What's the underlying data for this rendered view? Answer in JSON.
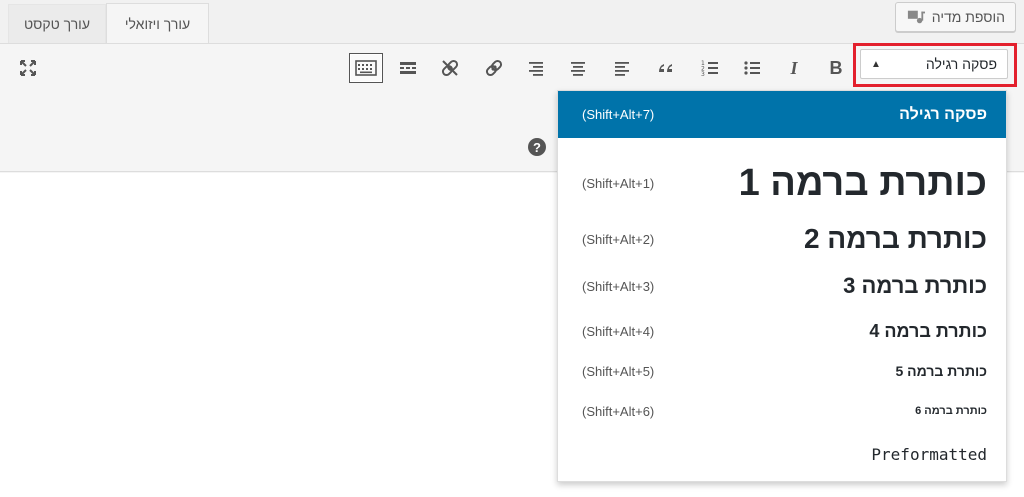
{
  "media_button": {
    "label": "הוספת מדיה",
    "icon": "media-icon"
  },
  "tabs": {
    "visual": "עורך ויזואלי",
    "text": "עורך טקסט"
  },
  "format_select": {
    "value": "פסקה רגילה"
  },
  "toolbar": {
    "icons": [
      "bold-icon",
      "italic-icon",
      "bullet-list-icon",
      "numbered-list-icon",
      "blockquote-icon",
      "align-left-icon",
      "align-center-icon",
      "align-right-icon",
      "link-icon",
      "unlink-icon",
      "read-more-icon",
      "toolbar-toggle-icon",
      "fullscreen-icon",
      "help-icon"
    ],
    "bold": "B",
    "italic": "I",
    "help": "?"
  },
  "dropdown": {
    "items": [
      {
        "label": "פסקה רגילה",
        "shortcut": "(Shift+Alt+7)",
        "selected": true
      },
      {
        "label": "כותרת ברמה 1",
        "shortcut": "(Shift+Alt+1)"
      },
      {
        "label": "כותרת ברמה 2",
        "shortcut": "(Shift+Alt+2)"
      },
      {
        "label": "כותרת ברמה 3",
        "shortcut": "(Shift+Alt+3)"
      },
      {
        "label": "כותרת ברמה 4",
        "shortcut": "(Shift+Alt+4)"
      },
      {
        "label": "כותרת ברמה 5",
        "shortcut": "(Shift+Alt+5)"
      },
      {
        "label": "כותרת ברמה 6",
        "shortcut": "(Shift+Alt+6)"
      },
      {
        "label": "Preformatted",
        "shortcut": ""
      }
    ]
  },
  "colors": {
    "selected_bg": "#0073aa",
    "highlight_border": "#e3202d"
  }
}
